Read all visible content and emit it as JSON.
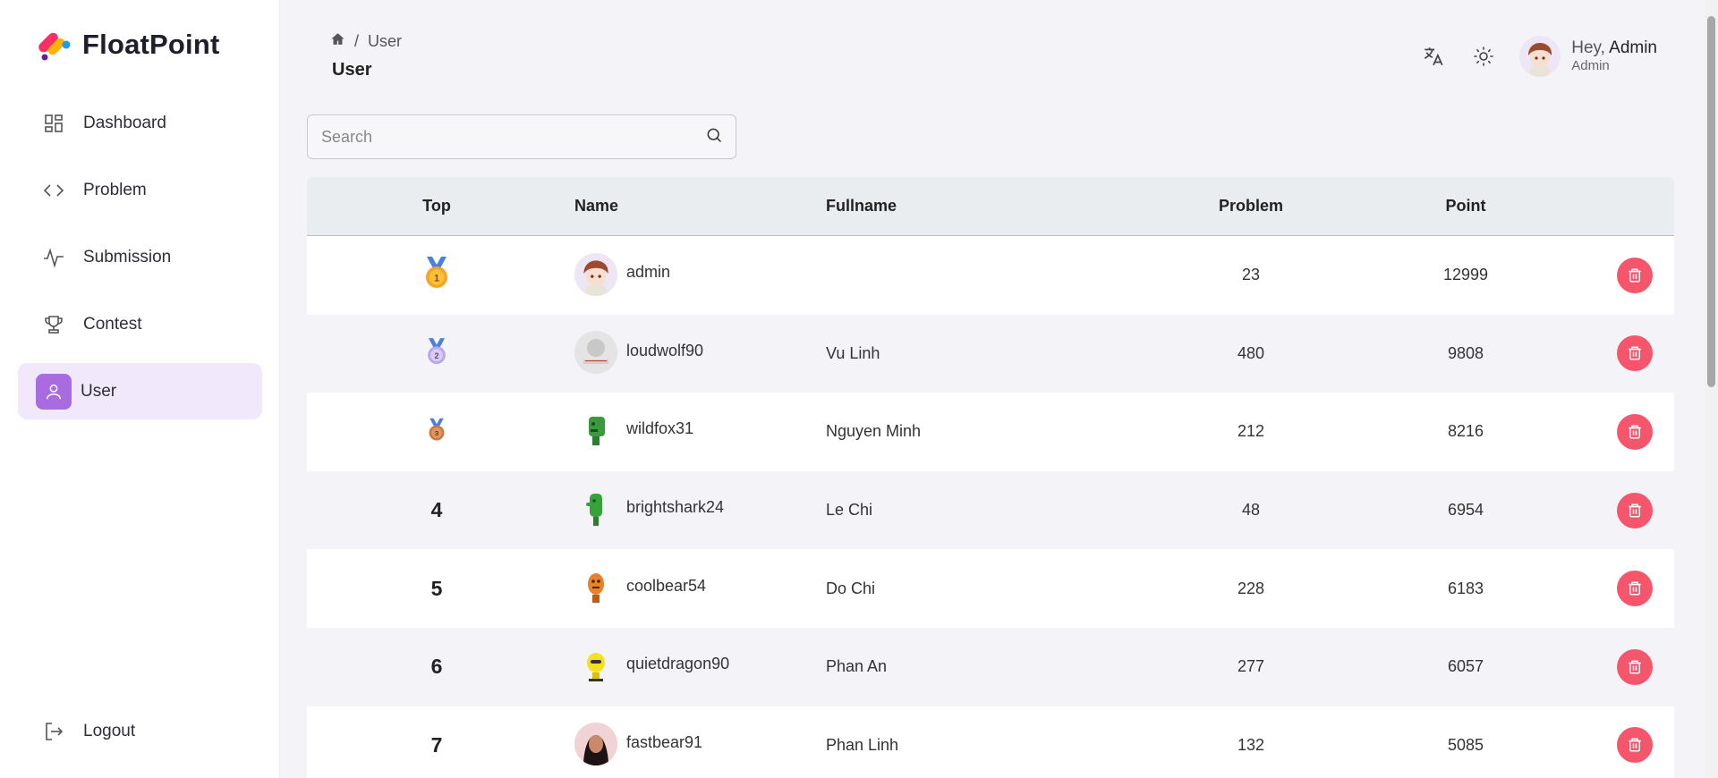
{
  "app": {
    "name": "FloatPoint"
  },
  "sidebar": {
    "items": [
      {
        "label": "Dashboard",
        "icon": "dashboard-icon"
      },
      {
        "label": "Problem",
        "icon": "code-icon"
      },
      {
        "label": "Submission",
        "icon": "activity-icon"
      },
      {
        "label": "Contest",
        "icon": "trophy-icon"
      },
      {
        "label": "User",
        "icon": "user-icon",
        "active": true
      }
    ],
    "logout_label": "Logout"
  },
  "breadcrumb": {
    "current": "User"
  },
  "page": {
    "title": "User"
  },
  "header": {
    "greeting": "Hey,",
    "username": "Admin",
    "role": "Admin"
  },
  "search": {
    "placeholder": "Search"
  },
  "table": {
    "columns": [
      "Top",
      "Name",
      "Fullname",
      "Problem",
      "Point"
    ],
    "rows": [
      {
        "top": "1",
        "name": "admin",
        "fullname": "",
        "problem": "23",
        "point": "12999",
        "badge": "gold-medal",
        "avatar": "anime-avatar"
      },
      {
        "top": "2",
        "name": "loudwolf90",
        "fullname": "Vu Linh",
        "problem": "480",
        "point": "9808",
        "badge": "silver-medal",
        "avatar": "default-avatar"
      },
      {
        "top": "3",
        "name": "wildfox31",
        "fullname": "Nguyen Minh",
        "problem": "212",
        "point": "8216",
        "badge": "bronze-medal",
        "avatar": "green-robot-avatar"
      },
      {
        "top": "4",
        "name": "brightshark24",
        "fullname": "Le Chi",
        "problem": "48",
        "point": "6954",
        "avatar": "green-robot-avatar"
      },
      {
        "top": "5",
        "name": "coolbear54",
        "fullname": "Do Chi",
        "problem": "228",
        "point": "6183",
        "avatar": "orange-robot-avatar"
      },
      {
        "top": "6",
        "name": "quietdragon90",
        "fullname": "Phan An",
        "problem": "277",
        "point": "6057",
        "avatar": "yellow-robot-avatar"
      },
      {
        "top": "7",
        "name": "fastbear91",
        "fullname": "Phan Linh",
        "problem": "132",
        "point": "5085",
        "avatar": "photo-avatar"
      }
    ]
  },
  "colors": {
    "accent": "#a86be0",
    "active_bg": "#f1e8fb",
    "delete": "#f6566c"
  }
}
